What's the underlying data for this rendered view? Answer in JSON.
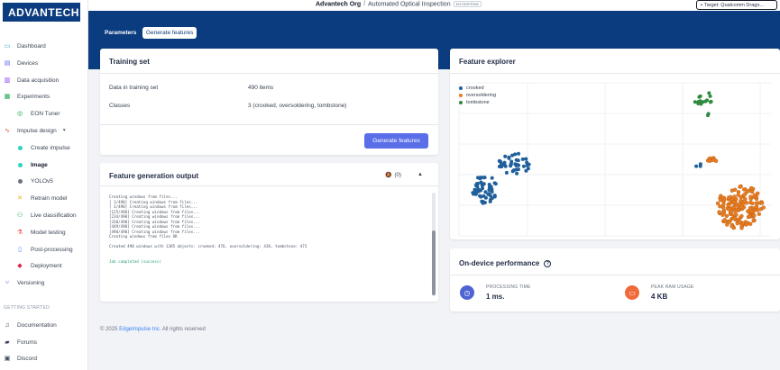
{
  "brand": {
    "logo_text": "ADVANTECH"
  },
  "sidebar": {
    "items": [
      {
        "label": "Dashboard"
      },
      {
        "label": "Devices"
      },
      {
        "label": "Data acquisition"
      },
      {
        "label": "Experiments"
      },
      {
        "label": "EON Tuner"
      },
      {
        "label": "Impulse design"
      },
      {
        "label": "Create impulse"
      },
      {
        "label": "Image"
      },
      {
        "label": "YOLOv5"
      },
      {
        "label": "Retrain model"
      },
      {
        "label": "Live classification"
      },
      {
        "label": "Model testing"
      },
      {
        "label": "Post-processing"
      },
      {
        "label": "Deployment"
      },
      {
        "label": "Versioning"
      }
    ],
    "getting_started_label": "GETTING STARTED",
    "getting_started": [
      {
        "label": "Documentation"
      },
      {
        "label": "Forums"
      },
      {
        "label": "Discord"
      }
    ]
  },
  "topbar": {
    "org": "Advantech Org",
    "separator": "/",
    "project": "Automated Optical Inspection",
    "badge": "ENTERPRISE",
    "target": "Target: Qualcomm Drago..."
  },
  "tabs": {
    "parameters": "Parameters",
    "generate": "Generate features"
  },
  "training_set": {
    "title": "Training set",
    "rows": [
      {
        "label": "Data in training set",
        "value": "490 items"
      },
      {
        "label": "Classes",
        "value": "3 (crooked, oversoldering, tombstone)"
      }
    ],
    "button": "Generate features"
  },
  "feature_output": {
    "title": "Feature generation output",
    "notif_count": "(0)",
    "lines": [
      "Creating windows from files...",
      "[   1/490] Creating windows from files...",
      "[   3/490] Creating windows from files...",
      "[125/490] Creating windows from files...",
      "[234/490] Creating windows from files...",
      "[338/490] Creating windows from files...",
      "[449/490] Creating windows from files...",
      "[490/490] Creating windows from files...",
      "Creating windows from files OK",
      "",
      "Created 490 windows with 1385 objects: crooked: 476, oversoldering: 436, tombstone: 473",
      "",
      ""
    ],
    "success": "Job completed (success)"
  },
  "feature_explorer": {
    "title": "Feature explorer",
    "legend": [
      {
        "name": "crooked",
        "color": "#1f5f9b"
      },
      {
        "name": "oversoldering",
        "color": "#e67e22"
      },
      {
        "name": "tombstone",
        "color": "#2e8b3e"
      }
    ]
  },
  "performance": {
    "title": "On-device performance",
    "processing_label": "PROCESSING TIME",
    "processing_value": "1 ms.",
    "ram_label": "PEAK RAM USAGE",
    "ram_value": "4 KB"
  },
  "footer": {
    "prefix": "© 2025",
    "link": "EdgeImpulse Inc.",
    "suffix": "All rights reserved"
  }
}
